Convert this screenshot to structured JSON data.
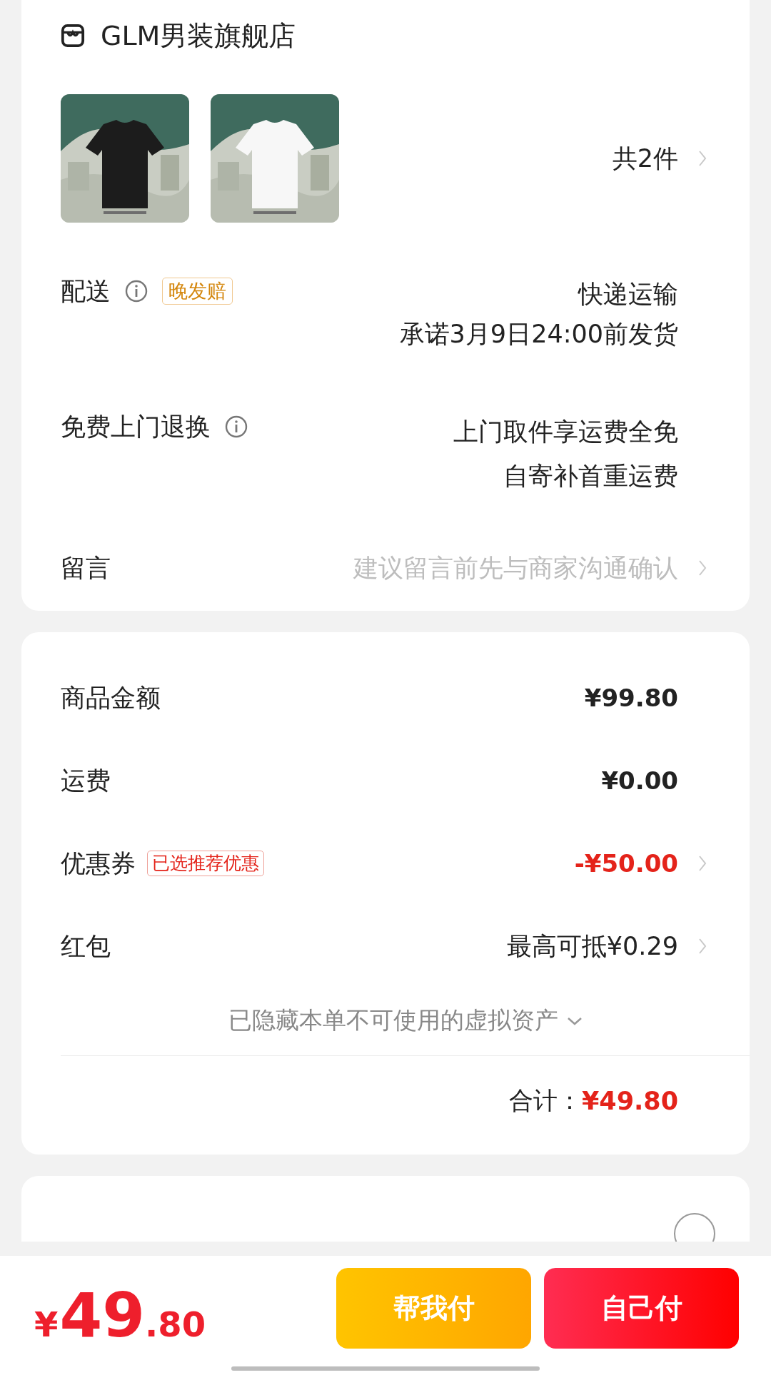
{
  "store": {
    "name": "GLM男装旗舰店"
  },
  "products": {
    "count": "共2件"
  },
  "delivery": {
    "label": "配送",
    "badge": "晚发赔",
    "lines": [
      "快递运输",
      "承诺3月9日24:00前发货"
    ]
  },
  "returns": {
    "label": "免费上门退换",
    "lines": [
      "上门取件享运费全免",
      "自寄补首重运费"
    ]
  },
  "message": {
    "label": "留言",
    "placeholder": "建议留言前先与商家沟通确认"
  },
  "price_rows": [
    {
      "label": "商品金额",
      "value": "¥99.80",
      "kind": "plain",
      "chevron": false
    },
    {
      "label": "运费",
      "value": "¥0.00",
      "kind": "plain",
      "chevron": false
    },
    {
      "label": "优惠券",
      "badge": "已选推荐优惠",
      "value": "-¥50.00",
      "kind": "discount",
      "chevron": true
    },
    {
      "label": "红包",
      "value": "最高可抵¥0.29",
      "kind": "plain",
      "chevron": true
    }
  ],
  "hidden_assets": "已隐藏本单不可使用的虚拟资产",
  "total": {
    "label": "合计：",
    "value": "¥49.80"
  },
  "baitiao": {
    "checked": false
  },
  "bottom_bar": {
    "currency": "¥",
    "integer": "49",
    "decimal": ".80",
    "buttons": [
      {
        "label": "帮我付",
        "kind": "secondary"
      },
      {
        "label": "自己付",
        "kind": "primary"
      }
    ]
  }
}
